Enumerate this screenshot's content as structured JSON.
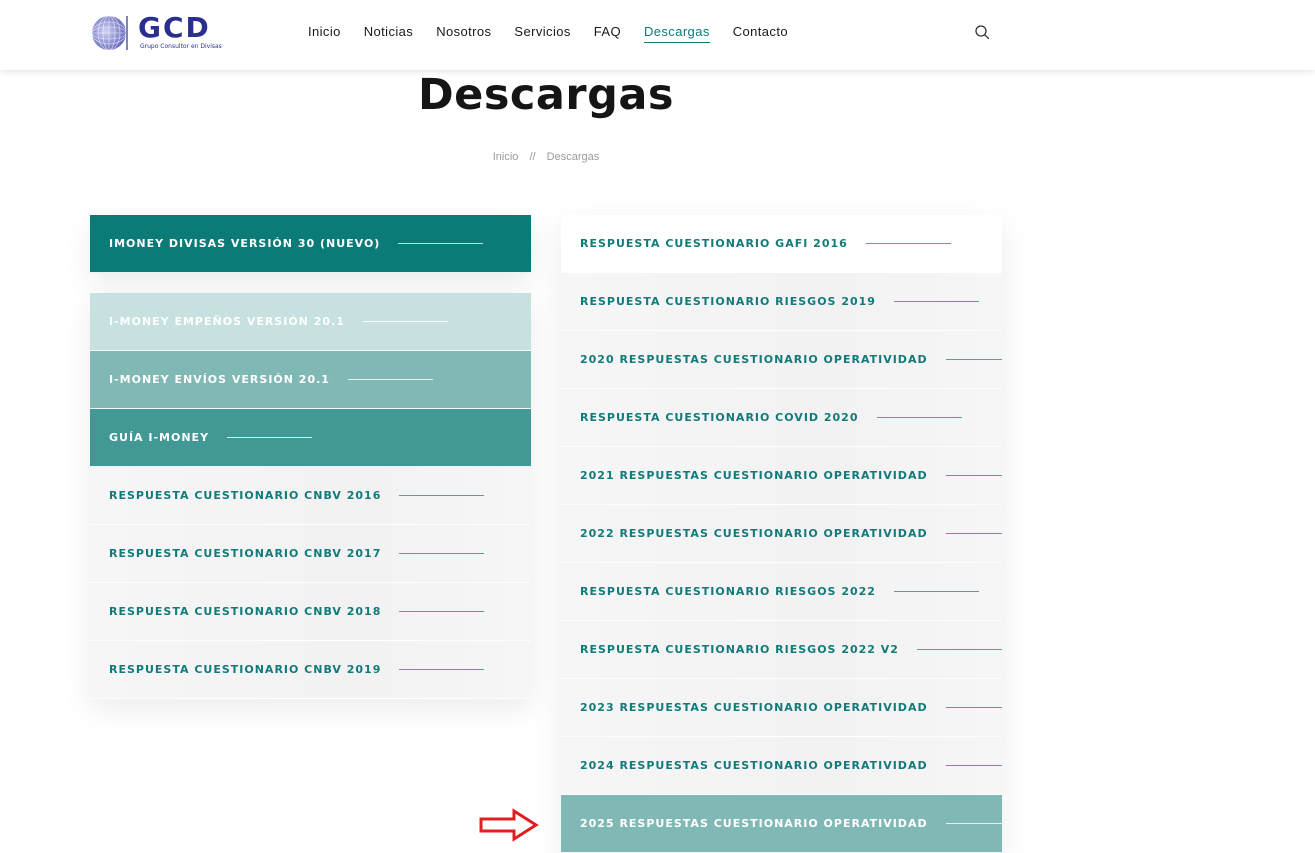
{
  "header": {
    "logo_text": "GCD",
    "logo_subtext": "Grupo Consultor en Divisas",
    "nav": [
      "Inicio",
      "Noticias",
      "Nosotros",
      "Servicios",
      "FAQ",
      "Descargas",
      "Contacto"
    ],
    "active_nav": "Descargas",
    "search_icon": "search-icon"
  },
  "page": {
    "title": "Descargas",
    "breadcrumb": [
      "Inicio",
      "//",
      "Descargas"
    ]
  },
  "left_column": {
    "top_item": "IMONEY DIVISAS VERSIÓN 30 (NUEVO)",
    "items": [
      "I-MONEY EMPEÑOS VERSIÓN 20.1",
      "I-MONEY ENVÍOS VERSIÓN 20.1",
      "GUÍA I-MONEY",
      "RESPUESTA CUESTIONARIO CNBV 2016",
      "RESPUESTA CUESTIONARIO CNBV 2017",
      "RESPUESTA CUESTIONARIO CNBV 2018",
      "RESPUESTA CUESTIONARIO CNBV 2019"
    ]
  },
  "right_column": {
    "items": [
      "RESPUESTA CUESTIONARIO GAFI 2016",
      "RESPUESTA CUESTIONARIO RIESGOS 2019",
      "2020 RESPUESTAS CUESTIONARIO OPERATIVIDAD",
      "RESPUESTA CUESTIONARIO COVID 2020",
      "2021 RESPUESTAS CUESTIONARIO OPERATIVIDAD",
      "2022 RESPUESTAS CUESTIONARIO OPERATIVIDAD",
      "RESPUESTA CUESTIONARIO RIESGOS 2022",
      "RESPUESTA CUESTIONARIO RIESGOS 2022 V2",
      "2023 RESPUESTAS CUESTIONARIO OPERATIVIDAD",
      "2024 RESPUESTAS CUESTIONARIO OPERATIVIDAD",
      "2025 RESPUESTAS CUESTIONARIO OPERATIVIDAD"
    ]
  },
  "colors": {
    "accent": "#0b7b78",
    "highlight_arrow": "#e02020",
    "brand": "#2a2f8f"
  }
}
